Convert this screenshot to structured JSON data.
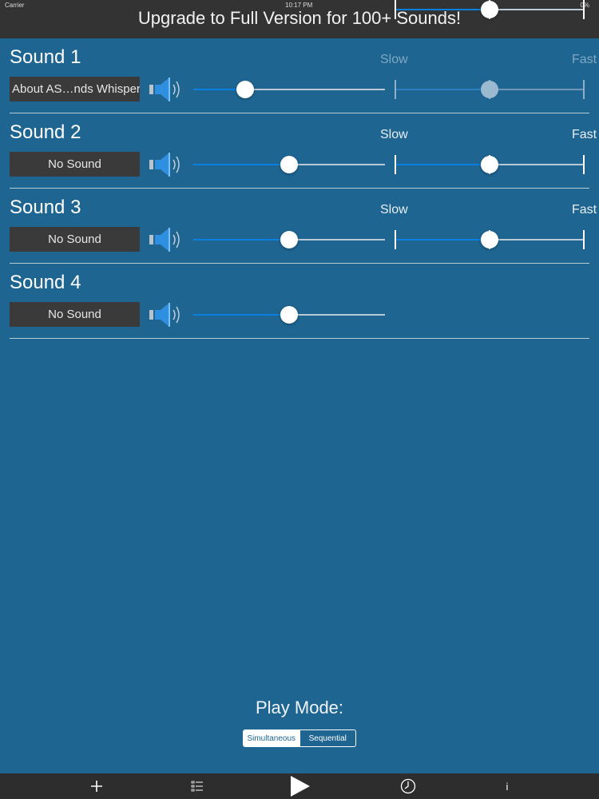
{
  "status_bar": {
    "carrier": "Carrier",
    "time": "10:17 PM",
    "battery": "0%"
  },
  "banner": {
    "text": "Upgrade to Full Version for 100+ Sounds!",
    "slider_value": 0.5
  },
  "speed_labels": {
    "slow": "Slow",
    "fast": "Fast"
  },
  "sounds": [
    {
      "title": "Sound 1",
      "button_label": "About AS…nds Whisper",
      "volume": 0.27,
      "speed": 0.5,
      "speed_enabled": false,
      "has_speed": true
    },
    {
      "title": "Sound 2",
      "button_label": "No Sound",
      "volume": 0.5,
      "speed": 0.5,
      "speed_enabled": true,
      "has_speed": true
    },
    {
      "title": "Sound 3",
      "button_label": "No Sound",
      "volume": 0.5,
      "speed": 0.5,
      "speed_enabled": true,
      "has_speed": true
    },
    {
      "title": "Sound 4",
      "button_label": "No Sound",
      "volume": 0.5,
      "has_speed": false
    }
  ],
  "play_mode": {
    "label": "Play Mode:",
    "options": [
      "Simultaneous",
      "Sequential"
    ],
    "selected": "Simultaneous"
  },
  "toolbar": {
    "info_label": "i",
    "icons": [
      "plus-icon",
      "list-icon",
      "play-icon",
      "clock-icon",
      "info-icon"
    ]
  },
  "colors": {
    "background": "#1e6591",
    "banner": "#333333",
    "accent": "#0a7fe0",
    "button": "#3a3a3a"
  }
}
